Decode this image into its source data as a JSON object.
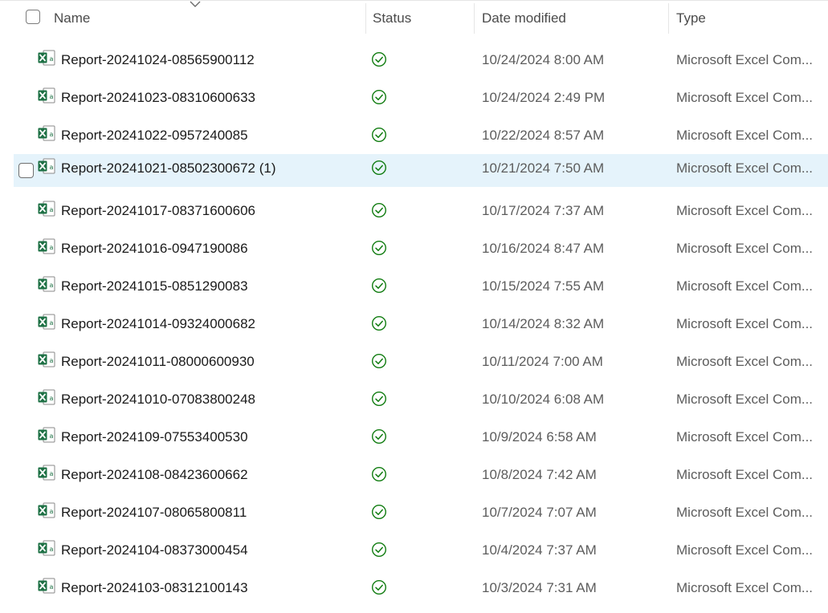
{
  "header": {
    "name": "Name",
    "status": "Status",
    "date_modified": "Date modified",
    "type": "Type"
  },
  "colors": {
    "excel_green": "#1d7044",
    "status_green": "#107c10",
    "selected_bg": "#e5f3fb"
  },
  "icons": {
    "file": "excel-file-icon",
    "status": "synced-check-icon",
    "sort": "chevron-down-icon"
  },
  "files": [
    {
      "name": "Report-20241024-08565900112",
      "date": "10/24/2024 8:00 AM",
      "type": "Microsoft Excel Com..."
    },
    {
      "name": "Report-20241023-08310600633",
      "date": "10/24/2024 2:49 PM",
      "type": "Microsoft Excel Com..."
    },
    {
      "name": "Report-20241022-0957240085",
      "date": "10/22/2024 8:57 AM",
      "type": "Microsoft Excel Com..."
    },
    {
      "name": "Report-20241021-08502300672 (1)",
      "date": "10/21/2024 7:50 AM",
      "type": "Microsoft Excel Com...",
      "selected": true
    },
    {
      "name": "Report-20241017-08371600606",
      "date": "10/17/2024 7:37 AM",
      "type": "Microsoft Excel Com..."
    },
    {
      "name": "Report-20241016-0947190086",
      "date": "10/16/2024 8:47 AM",
      "type": "Microsoft Excel Com..."
    },
    {
      "name": "Report-20241015-0851290083",
      "date": "10/15/2024 7:55 AM",
      "type": "Microsoft Excel Com..."
    },
    {
      "name": "Report-20241014-09324000682",
      "date": "10/14/2024 8:32 AM",
      "type": "Microsoft Excel Com..."
    },
    {
      "name": "Report-20241011-08000600930",
      "date": "10/11/2024 7:00 AM",
      "type": "Microsoft Excel Com..."
    },
    {
      "name": "Report-20241010-07083800248",
      "date": "10/10/2024 6:08 AM",
      "type": "Microsoft Excel Com..."
    },
    {
      "name": "Report-2024109-07553400530",
      "date": "10/9/2024 6:58 AM",
      "type": "Microsoft Excel Com..."
    },
    {
      "name": "Report-2024108-08423600662",
      "date": "10/8/2024 7:42 AM",
      "type": "Microsoft Excel Com..."
    },
    {
      "name": "Report-2024107-08065800811",
      "date": "10/7/2024 7:07 AM",
      "type": "Microsoft Excel Com..."
    },
    {
      "name": "Report-2024104-08373000454",
      "date": "10/4/2024 7:37 AM",
      "type": "Microsoft Excel Com..."
    },
    {
      "name": "Report-2024103-08312100143",
      "date": "10/3/2024 7:31 AM",
      "type": "Microsoft Excel Com..."
    }
  ]
}
